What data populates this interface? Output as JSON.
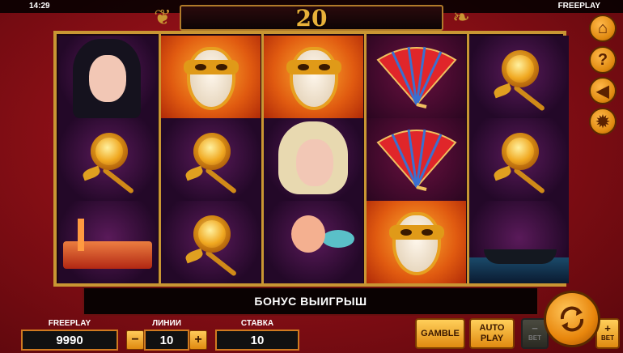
{
  "status_bar": {
    "time": "14:29",
    "mode": "FREEPLAY"
  },
  "title": {
    "number": "20"
  },
  "reels": [
    [
      "woman-dark-icon",
      "golden-rose-icon",
      "venice-night-icon"
    ],
    [
      "gold-mask-icon",
      "golden-rose-icon",
      "golden-rose-icon"
    ],
    [
      "gold-mask-icon",
      "woman-blonde-icon",
      "cupid-icon"
    ],
    [
      "red-fan-icon",
      "red-fan-icon",
      "gold-mask-icon"
    ],
    [
      "golden-rose-icon",
      "golden-rose-icon",
      "gondola-icon"
    ]
  ],
  "message": "БОНУС ВЫИГРЫШ",
  "side_menu": [
    "home-icon",
    "help-icon",
    "sound-icon",
    "settings-icon"
  ],
  "bottom": {
    "balance_label": "FREEPLAY",
    "balance_value": "9990",
    "lines_label": "ЛИНИИ",
    "lines_value": "10",
    "minus": "−",
    "plus": "+",
    "bet_label": "СТАВКА",
    "bet_value": "10",
    "gamble": "GAMBLE",
    "auto_top": "AUTO",
    "auto_bottom": "PLAY",
    "bet_minus": "BET",
    "bet_plus": "BET"
  },
  "colors": {
    "frame_gold": "#c99633",
    "button_orange": "#e08a10",
    "background_red": "#8a0f16"
  }
}
